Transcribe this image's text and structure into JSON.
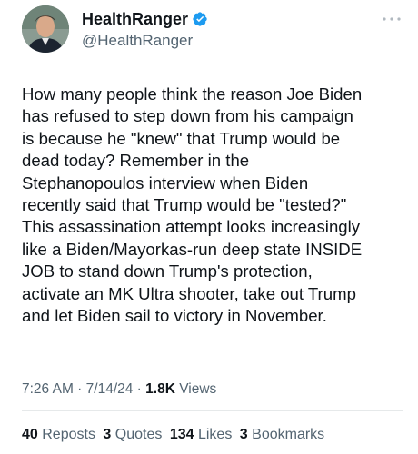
{
  "author": {
    "display_name": "HealthRanger",
    "handle": "@HealthRanger",
    "verified": true,
    "verified_color": "#1d9bf0"
  },
  "more_icon": "more-horizontal-icon",
  "tweet": {
    "lines": [
      "How many people think the reason Joe Biden",
      "has refused to step down from his campaign",
      "is because he \"knew\" that Trump would be",
      "dead today? Remember in the",
      "Stephanopoulos interview when Biden",
      "recently said that Trump would be \"tested?\"",
      "This assassination attempt looks increasingly",
      "like a Biden/Mayorkas-run deep state INSIDE",
      "JOB to stand down Trump's protection,",
      "activate an MK Ultra shooter, take out Trump",
      "and let Biden sail to victory in November."
    ],
    "time": "7:26 AM",
    "separator": " · ",
    "date": "7/14/24",
    "views_count": "1.8K",
    "views_label": "Views"
  },
  "stats": {
    "reposts_count": "40",
    "reposts_label": "Reposts",
    "quotes_count": "3",
    "quotes_label": "Quotes",
    "likes_count": "134",
    "likes_label": "Likes",
    "bookmarks_count": "3",
    "bookmarks_label": "Bookmarks"
  }
}
